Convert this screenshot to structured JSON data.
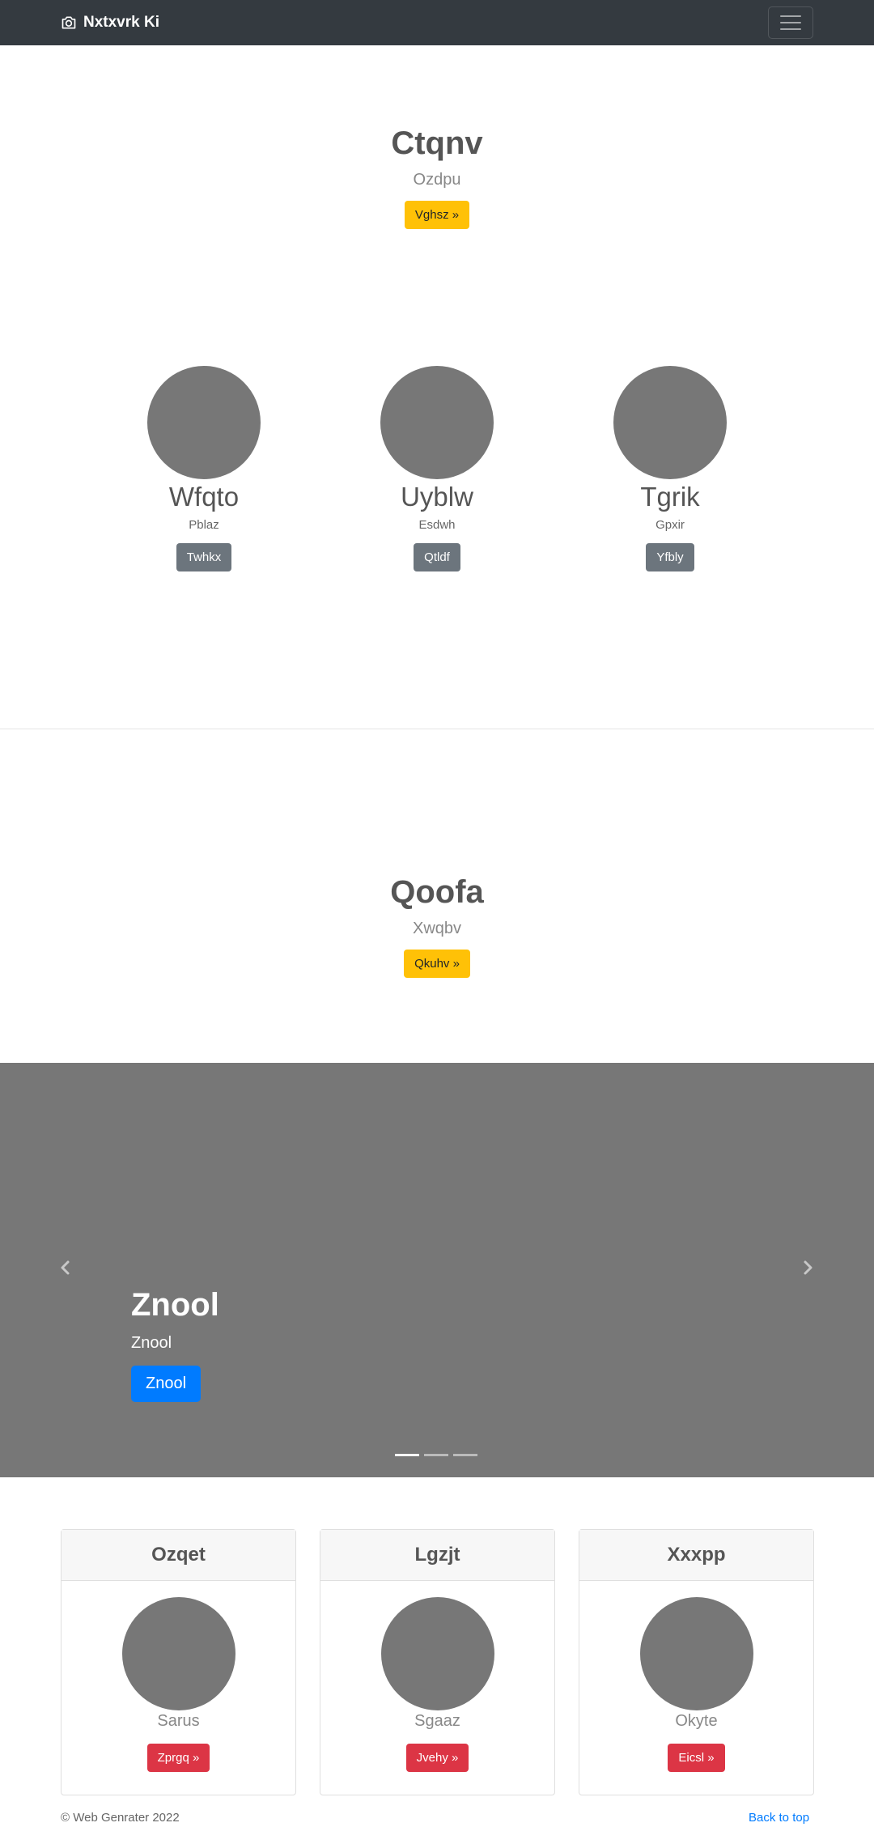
{
  "navbar": {
    "brand": "Nxtxvrk Ki",
    "brand_icon": "camera-icon",
    "toggler_icon": "hamburger-icon"
  },
  "hero1": {
    "title": "Ctqnv",
    "subtitle": "Ozdpu",
    "button": "Vghsz »"
  },
  "circles": [
    {
      "title": "Wfqto",
      "text": "Pblaz",
      "button": "Twhkx"
    },
    {
      "title": "Uyblw",
      "text": "Esdwh",
      "button": "Qtldf"
    },
    {
      "title": "Tgrik",
      "text": "Gpxir",
      "button": "Yfbly"
    }
  ],
  "hero2": {
    "title": "Qoofa",
    "subtitle": "Xwqbv",
    "button": "Qkuhv »"
  },
  "carousel": {
    "title": "Znool",
    "text": "Znool",
    "button": "Znool",
    "prev_icon": "chevron-left-icon",
    "next_icon": "chevron-right-icon",
    "slide_count": 3,
    "active_slide": 1
  },
  "cards": [
    {
      "header": "Ozqet",
      "text": "Sarus",
      "button": "Zprgq »"
    },
    {
      "header": "Lgzjt",
      "text": "Sgaaz",
      "button": "Jvehy »"
    },
    {
      "header": "Xxxpp",
      "text": "Okyte",
      "button": "Eicsl »"
    }
  ],
  "footer": {
    "copyright": "© Web Genrater 2022",
    "back_to_top": "Back to top"
  },
  "colors": {
    "navbar": "#343a40",
    "warning": "#ffc107",
    "secondary": "#6c757d",
    "primary": "#007bff",
    "danger": "#dc3545",
    "placeholder": "#777777"
  }
}
